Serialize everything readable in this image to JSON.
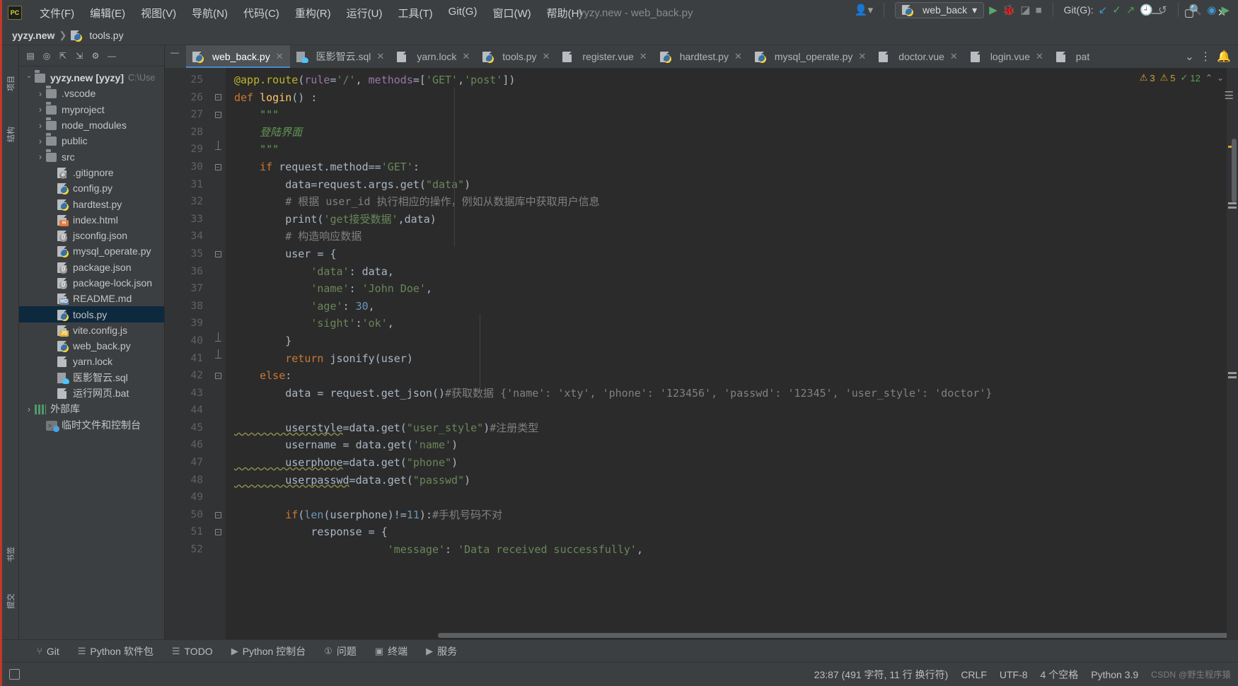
{
  "window": {
    "title": "yyzy.new - web_back.py",
    "logo": "PC",
    "minimize": "—",
    "maximize": "▢",
    "close": "✕"
  },
  "menu": [
    {
      "label": "文件(F)"
    },
    {
      "label": "编辑(E)"
    },
    {
      "label": "视图(V)"
    },
    {
      "label": "导航(N)"
    },
    {
      "label": "代码(C)"
    },
    {
      "label": "重构(R)"
    },
    {
      "label": "运行(U)"
    },
    {
      "label": "工具(T)"
    },
    {
      "label": "Git(G)"
    },
    {
      "label": "窗口(W)"
    },
    {
      "label": "帮助(H)"
    }
  ],
  "breadcrumb": {
    "root": "yyzy.new",
    "separator": "❯",
    "file": "tools.py"
  },
  "runbar": {
    "user_icon": "user-icon",
    "config_name": "web_back",
    "config_caret": "▾",
    "run": "▶",
    "debug": "debug-icon",
    "coverage": "coverage-icon",
    "stop": "■",
    "git_label": "Git(G):",
    "git_update": "↙",
    "git_commit": "✓",
    "git_push": "↗",
    "history": "history-icon",
    "rollback": "↺",
    "search": "search-icon",
    "user2": "account-icon",
    "feedback": "feedback-icon"
  },
  "sidebar": {
    "vertical_tabs": [
      {
        "label": "项目"
      },
      {
        "label": "结构"
      },
      {
        "label": "书签"
      },
      {
        "label": "提交"
      }
    ],
    "toolbar": [
      {
        "name": "window-icon",
        "glyph": "▤"
      },
      {
        "name": "locate-icon",
        "glyph": "◎"
      },
      {
        "name": "expand-all-icon",
        "glyph": "⇱"
      },
      {
        "name": "collapse-all-icon",
        "glyph": "⇲"
      },
      {
        "name": "settings-icon",
        "glyph": "⚙"
      },
      {
        "name": "hide-icon",
        "glyph": "—"
      }
    ],
    "tree": [
      {
        "label": "yyzy.new [yyzy]",
        "path": "C:\\Use",
        "icon": "folder",
        "indent": 0,
        "arrow": "open",
        "bold": true
      },
      {
        "label": ".vscode",
        "icon": "folder",
        "indent": 1,
        "arrow": "closed"
      },
      {
        "label": "myproject",
        "icon": "folder",
        "indent": 1,
        "arrow": "closed"
      },
      {
        "label": "node_modules",
        "icon": "folder",
        "indent": 1,
        "arrow": "closed"
      },
      {
        "label": "public",
        "icon": "folder",
        "indent": 1,
        "arrow": "closed"
      },
      {
        "label": "src",
        "icon": "folder",
        "indent": 1,
        "arrow": "closed"
      },
      {
        "label": ".gitignore",
        "icon": "git",
        "indent": 2,
        "arrow": "none"
      },
      {
        "label": "config.py",
        "icon": "py",
        "indent": 2,
        "arrow": "none"
      },
      {
        "label": "hardtest.py",
        "icon": "py",
        "indent": 2,
        "arrow": "none"
      },
      {
        "label": "index.html",
        "icon": "html",
        "indent": 2,
        "arrow": "none"
      },
      {
        "label": "jsconfig.json",
        "icon": "json",
        "indent": 2,
        "arrow": "none"
      },
      {
        "label": "mysql_operate.py",
        "icon": "py",
        "indent": 2,
        "arrow": "none"
      },
      {
        "label": "package.json",
        "icon": "json",
        "indent": 2,
        "arrow": "none"
      },
      {
        "label": "package-lock.json",
        "icon": "json",
        "indent": 2,
        "arrow": "none"
      },
      {
        "label": "README.md",
        "icon": "md",
        "indent": 2,
        "arrow": "none"
      },
      {
        "label": "tools.py",
        "icon": "py",
        "indent": 2,
        "arrow": "none",
        "selected": true
      },
      {
        "label": "vite.config.js",
        "icon": "js",
        "indent": 2,
        "arrow": "none"
      },
      {
        "label": "web_back.py",
        "icon": "py",
        "indent": 2,
        "arrow": "none"
      },
      {
        "label": "yarn.lock",
        "icon": "file",
        "indent": 2,
        "arrow": "none"
      },
      {
        "label": "医影智云.sql",
        "icon": "sql",
        "indent": 2,
        "arrow": "none"
      },
      {
        "label": "运行网页.bat",
        "icon": "file",
        "indent": 2,
        "arrow": "none"
      },
      {
        "label": "外部库",
        "icon": "lib",
        "indent": 0,
        "arrow": "closed"
      },
      {
        "label": "临时文件和控制台",
        "icon": "console",
        "indent": 1,
        "arrow": "none"
      }
    ]
  },
  "tabs": [
    {
      "label": "web_back.py",
      "icon": "py",
      "active": true
    },
    {
      "label": "医影智云.sql",
      "icon": "sql",
      "active": false
    },
    {
      "label": "yarn.lock",
      "icon": "file",
      "active": false
    },
    {
      "label": "tools.py",
      "icon": "py",
      "active": false
    },
    {
      "label": "register.vue",
      "icon": "file",
      "active": false
    },
    {
      "label": "hardtest.py",
      "icon": "py",
      "active": false
    },
    {
      "label": "mysql_operate.py",
      "icon": "py",
      "active": false
    },
    {
      "label": "doctor.vue",
      "icon": "file",
      "active": false
    },
    {
      "label": "login.vue",
      "icon": "file",
      "active": false
    },
    {
      "label": "pat",
      "icon": "file",
      "active": false
    }
  ],
  "tabbar_end": {
    "chevron": "⌄",
    "more": "⋮",
    "notification": "notification-icon"
  },
  "inspections": {
    "warning_count": "3",
    "error_count": "5",
    "ok_count": "12",
    "warning_glyph": "⚠",
    "error_glyph": "⚠",
    "ok_glyph": "✓",
    "up": "⌃",
    "down": "⌄",
    "menu": "☰"
  },
  "editor": {
    "first_line": 25,
    "lines": [
      {
        "n": 25,
        "fold": "none",
        "tokens": [
          {
            "t": "@app.route",
            "c": "dec"
          },
          {
            "t": "(",
            "c": "plain"
          },
          {
            "t": "rule",
            "c": "param"
          },
          {
            "t": "=",
            "c": "plain"
          },
          {
            "t": "'/'",
            "c": "str"
          },
          {
            "t": ", ",
            "c": "plain"
          },
          {
            "t": "methods",
            "c": "param"
          },
          {
            "t": "=[",
            "c": "plain"
          },
          {
            "t": "'GET'",
            "c": "str"
          },
          {
            "t": ",",
            "c": "plain"
          },
          {
            "t": "'post'",
            "c": "str"
          },
          {
            "t": "])",
            "c": "plain"
          }
        ]
      },
      {
        "n": 26,
        "fold": "start",
        "tokens": [
          {
            "t": "def ",
            "c": "kw"
          },
          {
            "t": "login",
            "c": "fn"
          },
          {
            "t": "() :",
            "c": "plain"
          }
        ]
      },
      {
        "n": 27,
        "fold": "start2",
        "tokens": [
          {
            "t": "    \"\"\"",
            "c": "doc"
          }
        ]
      },
      {
        "n": 28,
        "fold": "none",
        "tokens": [
          {
            "t": "    登陆界面",
            "c": "doc"
          }
        ]
      },
      {
        "n": 29,
        "fold": "end2",
        "tokens": [
          {
            "t": "    \"\"\"",
            "c": "doc"
          }
        ]
      },
      {
        "n": 30,
        "fold": "start2",
        "tokens": [
          {
            "t": "    ",
            "c": "plain"
          },
          {
            "t": "if ",
            "c": "kw"
          },
          {
            "t": "request.method==",
            "c": "plain"
          },
          {
            "t": "'GET'",
            "c": "str"
          },
          {
            "t": ":",
            "c": "plain"
          }
        ]
      },
      {
        "n": 31,
        "fold": "none",
        "tokens": [
          {
            "t": "        data=request.args.get(",
            "c": "plain"
          },
          {
            "t": "\"data\"",
            "c": "str"
          },
          {
            "t": ")",
            "c": "plain"
          }
        ]
      },
      {
        "n": 32,
        "fold": "none",
        "tokens": [
          {
            "t": "        # 根据 user_id 执行相应的操作，例如从数据库中获取用户信息",
            "c": "cmt"
          }
        ]
      },
      {
        "n": 33,
        "fold": "none",
        "tokens": [
          {
            "t": "        print(",
            "c": "plain"
          },
          {
            "t": "'get接受数据'",
            "c": "str"
          },
          {
            "t": ",data)",
            "c": "plain"
          }
        ]
      },
      {
        "n": 34,
        "fold": "none",
        "tokens": [
          {
            "t": "        # 构造响应数据",
            "c": "cmt"
          }
        ]
      },
      {
        "n": 35,
        "fold": "start2",
        "tokens": [
          {
            "t": "        user = {",
            "c": "plain"
          }
        ]
      },
      {
        "n": 36,
        "fold": "none",
        "tokens": [
          {
            "t": "            ",
            "c": "plain"
          },
          {
            "t": "'data'",
            "c": "str"
          },
          {
            "t": ": data,",
            "c": "plain"
          }
        ]
      },
      {
        "n": 37,
        "fold": "none",
        "tokens": [
          {
            "t": "            ",
            "c": "plain"
          },
          {
            "t": "'name'",
            "c": "str"
          },
          {
            "t": ": ",
            "c": "plain"
          },
          {
            "t": "'John Doe'",
            "c": "str"
          },
          {
            "t": ",",
            "c": "plain"
          }
        ]
      },
      {
        "n": 38,
        "fold": "none",
        "tokens": [
          {
            "t": "            ",
            "c": "plain"
          },
          {
            "t": "'age'",
            "c": "str"
          },
          {
            "t": ": ",
            "c": "plain"
          },
          {
            "t": "30",
            "c": "num"
          },
          {
            "t": ",",
            "c": "plain"
          }
        ]
      },
      {
        "n": 39,
        "fold": "none",
        "tokens": [
          {
            "t": "            ",
            "c": "plain"
          },
          {
            "t": "'sight'",
            "c": "str"
          },
          {
            "t": ":",
            "c": "plain"
          },
          {
            "t": "'ok'",
            "c": "str"
          },
          {
            "t": ",",
            "c": "plain"
          }
        ]
      },
      {
        "n": 40,
        "fold": "end2",
        "tokens": [
          {
            "t": "        }",
            "c": "plain"
          }
        ]
      },
      {
        "n": 41,
        "fold": "end2",
        "tokens": [
          {
            "t": "        ",
            "c": "plain"
          },
          {
            "t": "return ",
            "c": "kw"
          },
          {
            "t": "jsonify(user)",
            "c": "plain"
          }
        ]
      },
      {
        "n": 42,
        "fold": "start2",
        "tokens": [
          {
            "t": "    ",
            "c": "plain"
          },
          {
            "t": "else",
            "c": "kw"
          },
          {
            "t": ":",
            "c": "plain"
          }
        ]
      },
      {
        "n": 43,
        "fold": "none",
        "tokens": [
          {
            "t": "        data = request.get_json()",
            "c": "plain"
          },
          {
            "t": "#获取数据 {'name': 'xty', 'phone': '123456', 'passwd': '12345', 'user_style': 'doctor'}",
            "c": "cmt"
          }
        ]
      },
      {
        "n": 44,
        "fold": "none",
        "tokens": [
          {
            "t": "",
            "c": "plain"
          }
        ]
      },
      {
        "n": 45,
        "fold": "none",
        "tokens": [
          {
            "t": "        userstyle",
            "c": "warnu"
          },
          {
            "t": "=data.get(",
            "c": "plain"
          },
          {
            "t": "\"user_style\"",
            "c": "str"
          },
          {
            "t": ")",
            "c": "plain"
          },
          {
            "t": "#注册类型",
            "c": "cmt"
          }
        ]
      },
      {
        "n": 46,
        "fold": "none",
        "tokens": [
          {
            "t": "        username = data.get(",
            "c": "plain"
          },
          {
            "t": "'name'",
            "c": "str"
          },
          {
            "t": ")",
            "c": "plain"
          }
        ]
      },
      {
        "n": 47,
        "fold": "none",
        "tokens": [
          {
            "t": "        userphone",
            "c": "warnu"
          },
          {
            "t": "=data.get(",
            "c": "plain"
          },
          {
            "t": "\"phone\"",
            "c": "str"
          },
          {
            "t": ")",
            "c": "plain"
          }
        ]
      },
      {
        "n": 48,
        "fold": "none",
        "tokens": [
          {
            "t": "        userpasswd",
            "c": "warnu"
          },
          {
            "t": "=data.get(",
            "c": "plain"
          },
          {
            "t": "\"passwd\"",
            "c": "str"
          },
          {
            "t": ")",
            "c": "plain"
          }
        ]
      },
      {
        "n": 49,
        "fold": "none",
        "tokens": [
          {
            "t": "",
            "c": "plain"
          }
        ]
      },
      {
        "n": 50,
        "fold": "start2",
        "tokens": [
          {
            "t": "        ",
            "c": "plain"
          },
          {
            "t": "if",
            "c": "kw"
          },
          {
            "t": "(",
            "c": "plain"
          },
          {
            "t": "len",
            "c": "num"
          },
          {
            "t": "(userphone)!=",
            "c": "plain"
          },
          {
            "t": "11",
            "c": "num"
          },
          {
            "t": ")",
            "c": "plain"
          },
          {
            "t": ":",
            "c": "plain"
          },
          {
            "t": "#手机号码不对",
            "c": "cmt"
          }
        ]
      },
      {
        "n": 51,
        "fold": "start2",
        "tokens": [
          {
            "t": "            response = {",
            "c": "plain"
          }
        ]
      },
      {
        "n": 52,
        "fold": "none",
        "tokens": [
          {
            "t": "                        ",
            "c": "plain"
          },
          {
            "t": "'message'",
            "c": "str"
          },
          {
            "t": ": ",
            "c": "plain"
          },
          {
            "t": "'Data received successfully'",
            "c": "str"
          },
          {
            "t": ",",
            "c": "plain"
          }
        ]
      }
    ]
  },
  "bottom_tools": [
    {
      "label": "Git",
      "icon": "git-branch-icon"
    },
    {
      "label": "Python 软件包",
      "icon": "package-icon"
    },
    {
      "label": "TODO",
      "icon": "todo-icon"
    },
    {
      "label": "Python 控制台",
      "icon": "console-icon"
    },
    {
      "label": "问题",
      "icon": "problems-icon"
    },
    {
      "label": "终端",
      "icon": "terminal-icon"
    },
    {
      "label": "服务",
      "icon": "services-icon"
    }
  ],
  "status": {
    "caret": "23:87 (491 字符, 11 行 换行符)",
    "line_sep": "CRLF",
    "encoding": "UTF-8",
    "indent": "4 个空格",
    "interpreter": "Python 3.9",
    "watermark": "CSDN @野生程序猿",
    "layout_icon": "layout-icon"
  }
}
